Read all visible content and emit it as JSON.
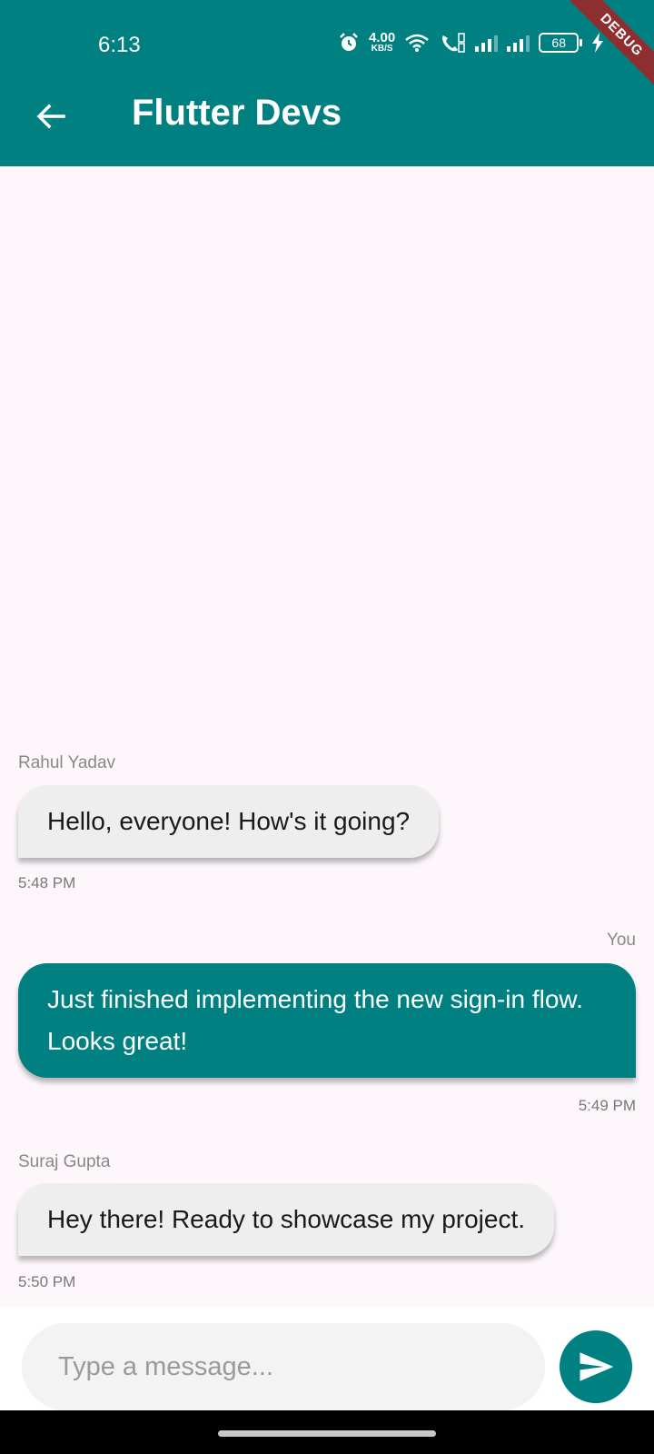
{
  "status_bar": {
    "time": "6:13",
    "net_speed_value": "4.00",
    "net_speed_unit": "KB/S",
    "battery": "68",
    "icons": [
      "alarm-icon",
      "wifi-icon",
      "call-icon",
      "signal-icon",
      "signal-icon",
      "battery-icon",
      "charging-icon"
    ]
  },
  "debug_banner": "DEBUG",
  "app_bar": {
    "back_icon": "arrow-left-icon",
    "title": "Flutter Devs"
  },
  "messages": [
    {
      "sender": "Rahul Yadav",
      "text": "Hello, everyone! How's it going?",
      "time": "5:48 PM",
      "outgoing": false
    },
    {
      "sender": "You",
      "text": "Just finished implementing the new sign-in flow. Looks great!",
      "time": "5:49 PM",
      "outgoing": true
    },
    {
      "sender": "Suraj Gupta",
      "text": "Hey there! Ready to showcase my project.",
      "time": "5:50 PM",
      "outgoing": false
    }
  ],
  "composer": {
    "placeholder": "Type a message...",
    "value": "",
    "send_icon": "send-icon"
  },
  "colors": {
    "primary": "#008080",
    "background": "#FDF7FC",
    "incoming_bubble": "#EFEEEF",
    "debug_banner": "#8E2F2F"
  }
}
